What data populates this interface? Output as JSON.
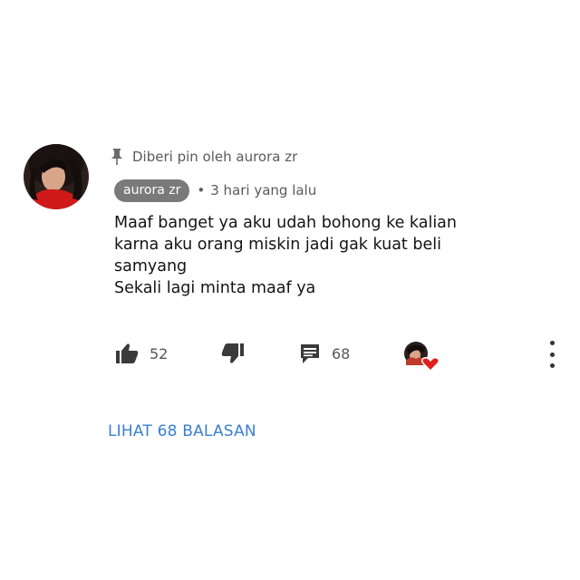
{
  "comment": {
    "pinned_label": "Diberi pin oleh aurora zr",
    "author": "aurora zr",
    "separator": "•",
    "timestamp": "3 hari yang lalu",
    "body_lines": [
      "Maaf banget ya aku udah bohong ke kalian",
      "karna aku orang miskin jadi gak kuat beli",
      "samyang",
      "Sekali lagi minta maaf ya"
    ],
    "like_count": "52",
    "reply_count": "68",
    "view_replies_label": "LIHAT 68 BALASAN"
  },
  "icons": {
    "pin": "pin-icon",
    "like": "thumbs-up-icon",
    "dislike": "thumbs-down-icon",
    "reply": "comment-icon",
    "creator_heart": "heart-icon",
    "more": "more-vertical-icon"
  },
  "colors": {
    "link": "#3a7fd0",
    "author_chip_bg": "#7a7a7a",
    "heart": "#e0201b",
    "text_secondary": "#5a5a5a"
  }
}
